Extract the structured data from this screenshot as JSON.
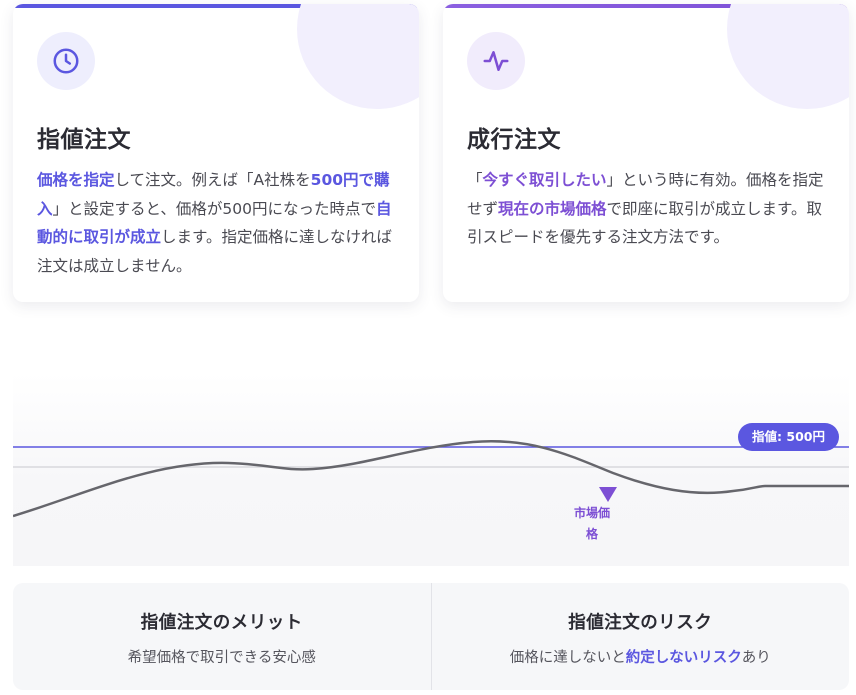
{
  "limit_card": {
    "title": "指値注文",
    "icon": "clock-icon",
    "accent": "#5b57e0",
    "desc": [
      {
        "text": "価格を指定",
        "hl": true
      },
      {
        "text": "して注文。例えば「A社株を",
        "hl": false
      },
      {
        "text": "500円で購入",
        "hl": true
      },
      {
        "text": "」と設定すると、価格が500円になった時点で",
        "hl": false
      },
      {
        "text": "自動的に取引が成立",
        "hl": true
      },
      {
        "text": "します。指定価格に達しなければ注文は成立しません。",
        "hl": false
      }
    ]
  },
  "market_card": {
    "title": "成行注文",
    "icon": "pulse-icon",
    "accent": "#7d4fd4",
    "desc": [
      {
        "text": "「",
        "hl": false
      },
      {
        "text": "今すぐ取引したい",
        "hl": true
      },
      {
        "text": "」という時に有効。価格を指定せず",
        "hl": false
      },
      {
        "text": "現在の市場価格",
        "hl": true
      },
      {
        "text": "で即座に取引が成立します。取引スピードを優先する注文方法です。",
        "hl": false
      }
    ]
  },
  "chart": {
    "limit_label": "指値: 500円",
    "market_label": "市場価格"
  },
  "merit": {
    "title": "指値注文のメリット",
    "text": "希望価格で取引できる安心感"
  },
  "risk": {
    "title": "指値注文のリスク",
    "text_before": "価格に達しないと",
    "text_hl": "約定しないリスク",
    "text_after": "あり"
  }
}
